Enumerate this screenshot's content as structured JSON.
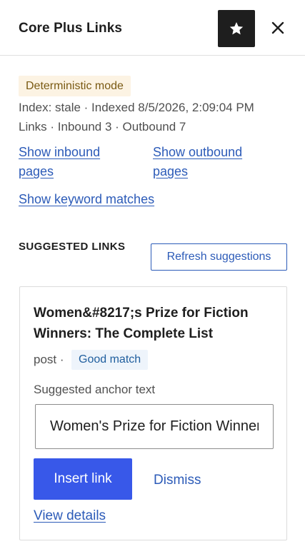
{
  "header": {
    "title": "Core Plus Links",
    "star_icon": "star-icon",
    "close_icon": "close-icon"
  },
  "status": {
    "mode_badge": "Deterministic mode",
    "index_line": "Index: stale · Indexed 8/5/2026, 2:09:04 PM",
    "links_line": "Links · Inbound 3 · Outbound 7"
  },
  "actions": {
    "show_inbound": "Show inbound pages",
    "show_outbound": "Show outbound pages",
    "show_keyword": "Show keyword matches"
  },
  "suggested": {
    "section_label": "SUGGESTED LINKS",
    "refresh_label": "Refresh suggestions",
    "items": [
      {
        "title": "Women&#8217;s Prize for Fiction Winners: The Complete List",
        "type": "post ·",
        "match": "Good match",
        "anchor_label": "Suggested anchor text",
        "anchor_value": "Women's Prize for Fiction Winners: The Complete List",
        "insert_label": "Insert link",
        "dismiss_label": "Dismiss",
        "details_label": "View details"
      }
    ]
  },
  "colors": {
    "accent": "#3858e9",
    "link": "#2c5bb8",
    "header_button": "#1e1e1e",
    "mode_badge_bg": "#fcf3e3",
    "match_badge_bg": "#eef4fb"
  }
}
